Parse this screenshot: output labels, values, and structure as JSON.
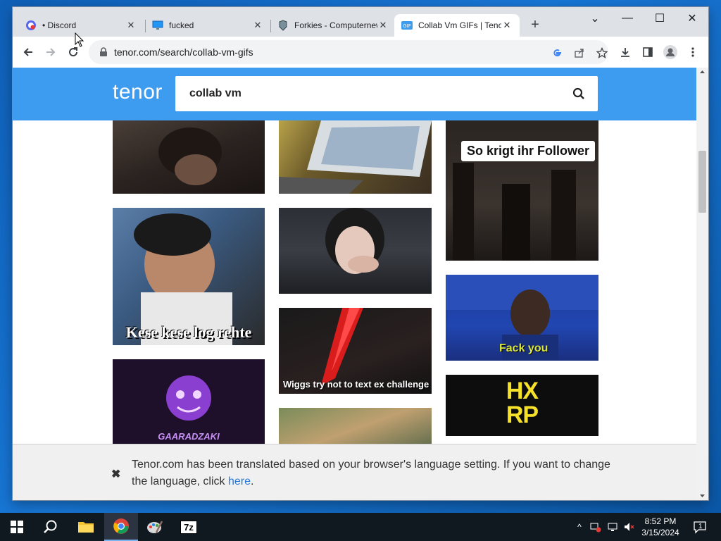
{
  "browser": {
    "tabs": [
      {
        "title": "• Discord",
        "favicon": "discord-icon",
        "active": false
      },
      {
        "title": "fucked",
        "favicon": "monitor-icon",
        "active": false
      },
      {
        "title": "Forkies - Computernewb",
        "favicon": "forkies-icon",
        "active": false
      },
      {
        "title": "Collab Vm GIFs | Tenor",
        "favicon": "gif-icon",
        "active": true
      }
    ],
    "new_tab_label": "+",
    "url": "tenor.com/search/collab-vm-gifs"
  },
  "tenor": {
    "logo": "tenor",
    "search_query": "collab vm",
    "gifs": [
      {
        "caption": ""
      },
      {
        "caption": ""
      },
      {
        "caption": "So krigt ihr Follower"
      },
      {
        "caption": "Kese kese log rehte"
      },
      {
        "caption": ""
      },
      {
        "caption": "Fack you"
      },
      {
        "caption": "Wiggs try not to text ex challenge"
      },
      {
        "caption": "GAARADZAKI"
      },
      {
        "caption": "HX RP"
      },
      {
        "caption": ""
      }
    ],
    "banner": {
      "message": "Tenor.com has been translated based on your browser's language setting. If you want to change the language, click ",
      "link": "here",
      "suffix": "."
    }
  },
  "taskbar": {
    "time": "8:52 PM",
    "date": "3/15/2024",
    "notification_count": "1",
    "seven_zip_label": "7z"
  },
  "colors": {
    "tenor_blue": "#3d9bf0",
    "chrome_tabstrip": "#dee1e6",
    "link": "#2a7ad7"
  }
}
